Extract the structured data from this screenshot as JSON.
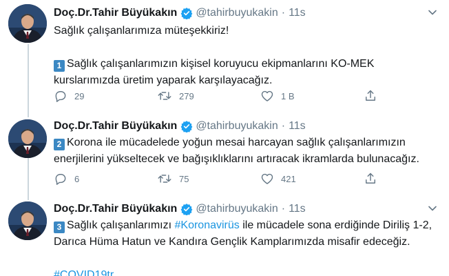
{
  "colors": {
    "link": "#1b95e0",
    "verified": "#1da1f2",
    "muted": "#657786",
    "keycap": "#3b88c3"
  },
  "icons": [
    "verified-badge-icon",
    "chevron-down-icon",
    "reply-icon",
    "retweet-icon",
    "like-icon",
    "share-icon"
  ],
  "tweets": [
    {
      "author": {
        "name": "Doç.Dr.Tahir Büyükakın",
        "handle": "@tahirbuyukakin",
        "separator": "·",
        "time": "11s"
      },
      "lines": [
        {
          "text": "Sağlık çalışanlarımıza müteşekkiriz!"
        },
        {
          "text": ""
        },
        {
          "keycap": "1",
          "text": "Sağlık çalışanlarımızın kişisel koruyucu ekipmanlarını KO-MEK"
        },
        {
          "text": "kurslarımızda üretim yaparak karşılayacağız."
        }
      ],
      "stats": {
        "replies": "29",
        "retweets": "279",
        "likes": "1 B"
      }
    },
    {
      "author": {
        "name": "Doç.Dr.Tahir Büyükakın",
        "handle": "@tahirbuyukakin",
        "separator": "·",
        "time": "11s"
      },
      "lines": [
        {
          "keycap": "2",
          "text": "Korona ile mücadelede yoğun mesai harcayan sağlık çalışanlarımızın"
        },
        {
          "text": "enerjilerini yükseltecek ve bağışıklıklarını artıracak ikramlarda bulunacağız."
        }
      ],
      "stats": {
        "replies": "6",
        "retweets": "75",
        "likes": "421"
      }
    },
    {
      "author": {
        "name": "Doç.Dr.Tahir Büyükakın",
        "handle": "@tahirbuyukakin",
        "separator": "·",
        "time": "11s"
      },
      "lines": [
        {
          "keycap": "3",
          "pre": "Sağlık çalışanlarımızı ",
          "hashtag": "#Koronavirüs",
          "post": " ile mücadele sona erdiğinde Diriliş 1-2,"
        },
        {
          "text": "Darıca Hüma Hatun ve Kandıra Gençlik Kamplarımızda misafir edeceğiz."
        },
        {
          "text": ""
        },
        {
          "hashtag": "#COVID19tr"
        }
      ]
    }
  ]
}
